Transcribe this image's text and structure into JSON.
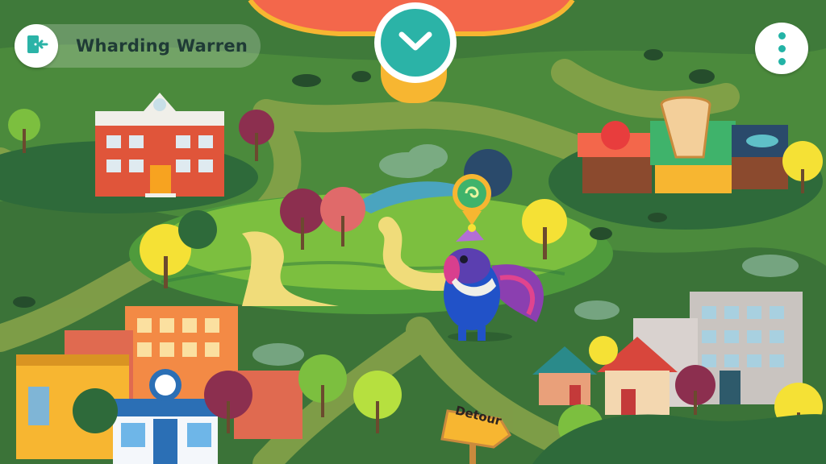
{
  "player": {
    "name": "Wharding Warren"
  },
  "hud": {
    "exit_icon": "exit-door-icon",
    "menu_icon": "vertical-dots-icon",
    "expand_icon": "chevron-down-icon"
  },
  "map": {
    "signpost": {
      "label": "Detour"
    },
    "locations": [
      "school",
      "market",
      "park",
      "apartments",
      "cafe",
      "houses"
    ],
    "quest_marker_icon": "spiral-emblem-icon"
  },
  "colors": {
    "accent": "#2bb3a7",
    "banner": "#f3674b",
    "banner_trim": "#f7b631",
    "grass_dark": "#3f7a3a",
    "path": "#c9c45e"
  }
}
